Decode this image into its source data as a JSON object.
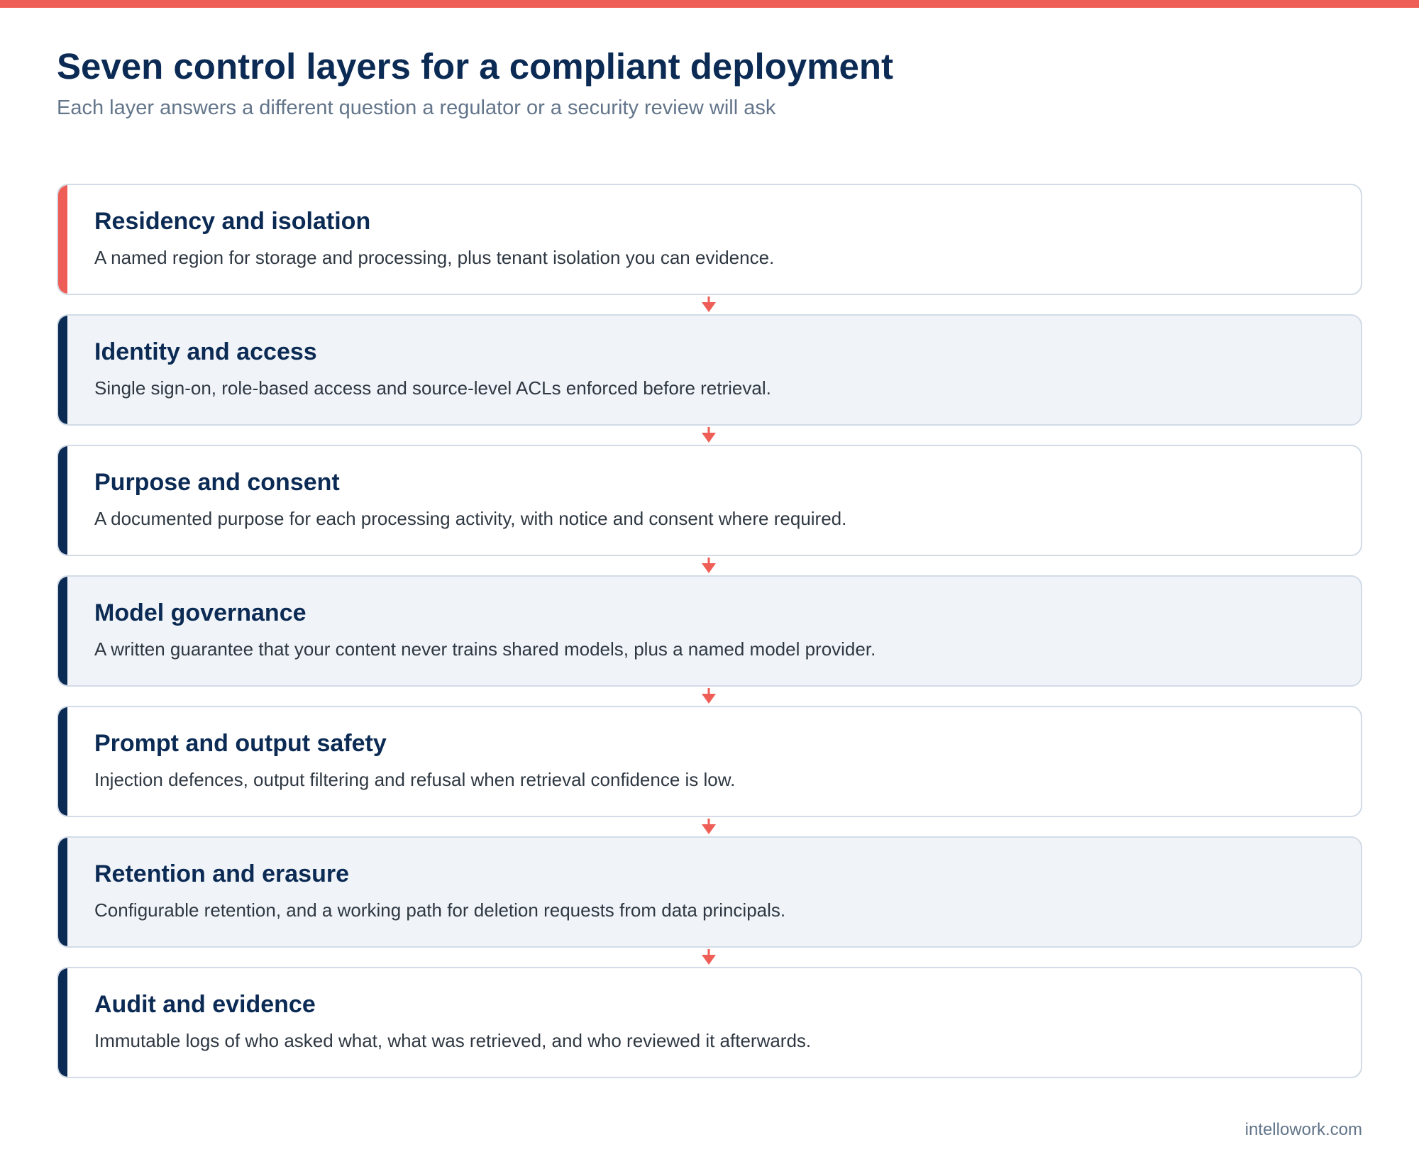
{
  "header": {
    "title": "Seven control layers for a compliant deployment",
    "subtitle": "Each layer answers a different question a regulator or a security review will ask"
  },
  "colors": {
    "accent": "#ee5e57",
    "navy": "#0b2a54",
    "muted_text": "#63758a",
    "card_shaded": "#f0f4f8",
    "card_border": "#d2dbe6"
  },
  "layers": [
    {
      "title": "Residency and isolation",
      "description": "A named region for storage and processing, plus tenant isolation you can evidence."
    },
    {
      "title": "Identity and access",
      "description": "Single sign-on, role-based access and source-level ACLs enforced before retrieval."
    },
    {
      "title": "Purpose and consent",
      "description": "A documented purpose for each processing activity, with notice and consent where required."
    },
    {
      "title": "Model governance",
      "description": "A written guarantee that your content never trains shared models, plus a named model provider."
    },
    {
      "title": "Prompt and output safety",
      "description": "Injection defences, output filtering and refusal when retrieval confidence is low."
    },
    {
      "title": "Retention and erasure",
      "description": "Configurable retention, and a working path for deletion requests from data principals."
    },
    {
      "title": "Audit and evidence",
      "description": "Immutable logs of who asked what, what was retrieved, and who reviewed it afterwards."
    }
  ],
  "connector_icon": "arrow-down-icon",
  "footer": {
    "brand": "intellowork.com"
  }
}
